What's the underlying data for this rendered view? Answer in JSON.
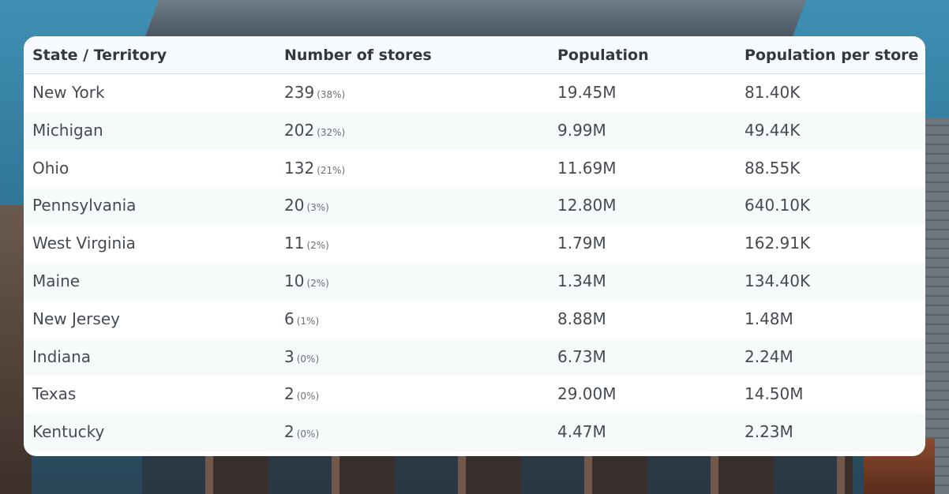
{
  "table": {
    "headers": [
      "State / Territory",
      "Number of stores",
      "Population",
      "Population per store"
    ],
    "rows": [
      {
        "state": "New York",
        "stores": "239",
        "pct": "(38%)",
        "population": "19.45M",
        "per_store": "81.40K"
      },
      {
        "state": "Michigan",
        "stores": "202",
        "pct": "(32%)",
        "population": "9.99M",
        "per_store": "49.44K"
      },
      {
        "state": "Ohio",
        "stores": "132",
        "pct": "(21%)",
        "population": "11.69M",
        "per_store": "88.55K"
      },
      {
        "state": "Pennsylvania",
        "stores": "20",
        "pct": "(3%)",
        "population": "12.80M",
        "per_store": "640.10K"
      },
      {
        "state": "West Virginia",
        "stores": "11",
        "pct": "(2%)",
        "population": "1.79M",
        "per_store": "162.91K"
      },
      {
        "state": "Maine",
        "stores": "10",
        "pct": "(2%)",
        "population": "1.34M",
        "per_store": "134.40K"
      },
      {
        "state": "New Jersey",
        "stores": "6",
        "pct": "(1%)",
        "population": "8.88M",
        "per_store": "1.48M"
      },
      {
        "state": "Indiana",
        "stores": "3",
        "pct": "(0%)",
        "population": "6.73M",
        "per_store": "2.24M"
      },
      {
        "state": "Texas",
        "stores": "2",
        "pct": "(0%)",
        "population": "29.00M",
        "per_store": "14.50M"
      },
      {
        "state": "Kentucky",
        "stores": "2",
        "pct": "(0%)",
        "population": "4.47M",
        "per_store": "2.23M"
      }
    ]
  }
}
